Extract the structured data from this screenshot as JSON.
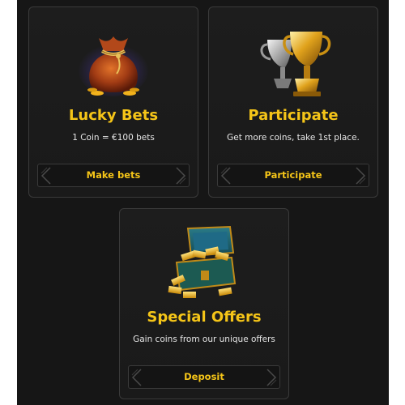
{
  "cards": [
    {
      "title": "Lucky Bets",
      "subtitle": "1 Coin = €100 bets",
      "button": "Make bets",
      "icon": "money-bag-icon"
    },
    {
      "title": "Participate",
      "subtitle": "Get more coins, take 1st place.",
      "button": "Participate",
      "icon": "trophy-icon"
    },
    {
      "title": "Special Offers",
      "subtitle": "Gain coins from our unique offers",
      "button": "Deposit",
      "icon": "treasure-chest-icon"
    }
  ],
  "colors": {
    "accent": "#f5c518",
    "background": "#161616",
    "card": "#1c1c1c",
    "border": "#3a3a3a"
  }
}
